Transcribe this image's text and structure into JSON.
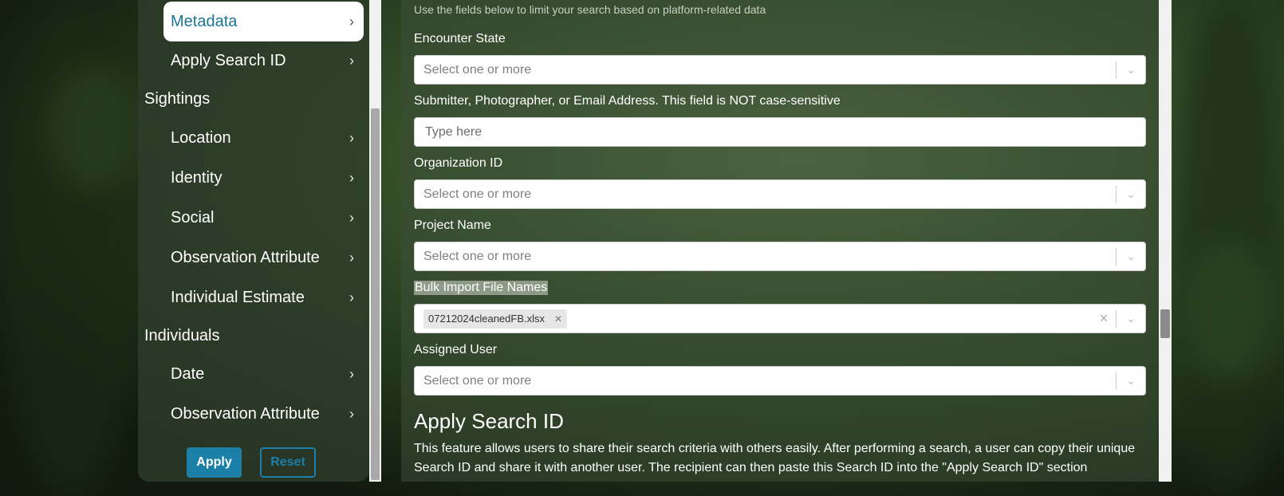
{
  "sidebar": {
    "items": [
      {
        "label": "Metadata",
        "active": true
      },
      {
        "label": "Apply Search ID"
      }
    ],
    "sections": [
      {
        "title": "Sightings",
        "items": [
          "Location",
          "Identity",
          "Social",
          "Observation Attribute",
          "Individual Estimate"
        ]
      },
      {
        "title": "Individuals",
        "items": [
          "Date",
          "Observation Attribute"
        ]
      }
    ],
    "apply_label": "Apply",
    "reset_label": "Reset"
  },
  "main": {
    "helper_text": "Use the fields below to limit your search based on platform-related data",
    "fields": {
      "encounter_state": {
        "label": "Encounter State",
        "placeholder": "Select one or more"
      },
      "submitter": {
        "label": "Submitter, Photographer, or Email Address. This field is NOT case-sensitive",
        "placeholder": "Type here"
      },
      "organization": {
        "label": "Organization ID",
        "placeholder": "Select one or more"
      },
      "project": {
        "label": "Project Name",
        "placeholder": "Select one or more"
      },
      "bulk_import": {
        "label": "Bulk Import File Names",
        "selected": "07212024cleanedFB.xlsx"
      },
      "assigned_user": {
        "label": "Assigned User",
        "placeholder": "Select one or more"
      }
    },
    "apply_search_id": {
      "title": "Apply Search ID",
      "description": "This feature allows users to share their search criteria with others easily. After performing a search, a user can copy their unique Search ID and share it with another user. The recipient can then paste this Search ID into the \"Apply Search ID\" section"
    }
  },
  "icons": {
    "chevron_right": "chevron-right-icon",
    "chevron_down": "chevron-down-icon",
    "clear": "clear-icon"
  },
  "colors": {
    "accent": "#1c7fa8",
    "active_text": "#1c7596"
  }
}
